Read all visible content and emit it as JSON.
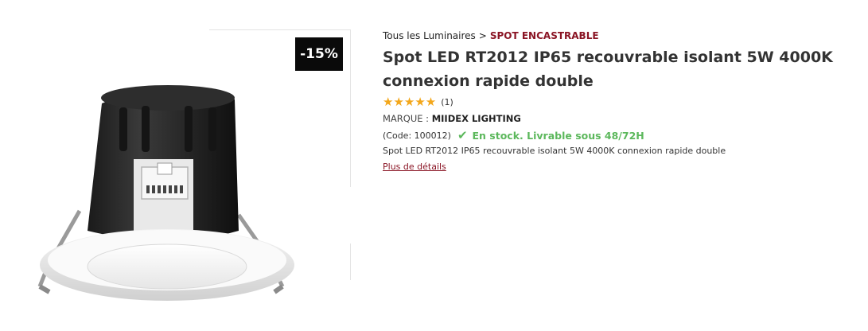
{
  "badge": {
    "discount": "-15%"
  },
  "breadcrumb": {
    "parent": "Tous les Luminaires",
    "separator": ">",
    "current": "SPOT ENCASTRABLE"
  },
  "product": {
    "title_line1": "Spot LED RT2012 IP65 recouvrable isolant 5W 4000K",
    "title_line2": "connexion rapide double",
    "stars": "★★★★★",
    "rating_value": 5,
    "rating_count": "(1)",
    "brand_label": "MARQUE :",
    "brand_name": "MIIDEX LIGHTING",
    "code": "(Code: 100012)",
    "stock": "En stock. Livrable sous 48/72H",
    "description": "Spot LED RT2012 IP65 recouvrable isolant 5W 4000K connexion rapide double",
    "more_link": "Plus de détails"
  },
  "colors": {
    "accent": "#8a1424",
    "stock": "#5cb85c",
    "star": "#f3a71b",
    "badge_bg": "#0a0a0a"
  },
  "icons": {
    "check": "check-icon",
    "star": "star-icon"
  }
}
